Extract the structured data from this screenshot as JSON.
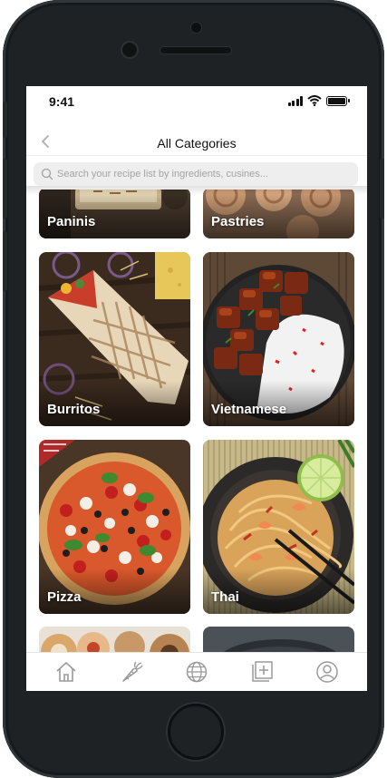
{
  "status": {
    "time": "9:41"
  },
  "nav": {
    "title": "All Categories"
  },
  "search": {
    "placeholder": "Search your recipe list by ingredients, cusines..."
  },
  "categories": [
    {
      "label": "Paninis"
    },
    {
      "label": "Pastries"
    },
    {
      "label": "Burritos"
    },
    {
      "label": "Vietnamese"
    },
    {
      "label": "Pizza"
    },
    {
      "label": "Thai"
    }
  ],
  "tabs": [
    {
      "icon": "home-icon"
    },
    {
      "icon": "carrot-icon"
    },
    {
      "icon": "globe-icon"
    },
    {
      "icon": "add-recipe-icon"
    },
    {
      "icon": "profile-icon"
    }
  ],
  "colors": {
    "icon_gray": "#9a9a9a",
    "text_dark": "#111111",
    "search_bg": "#eeeeee"
  }
}
